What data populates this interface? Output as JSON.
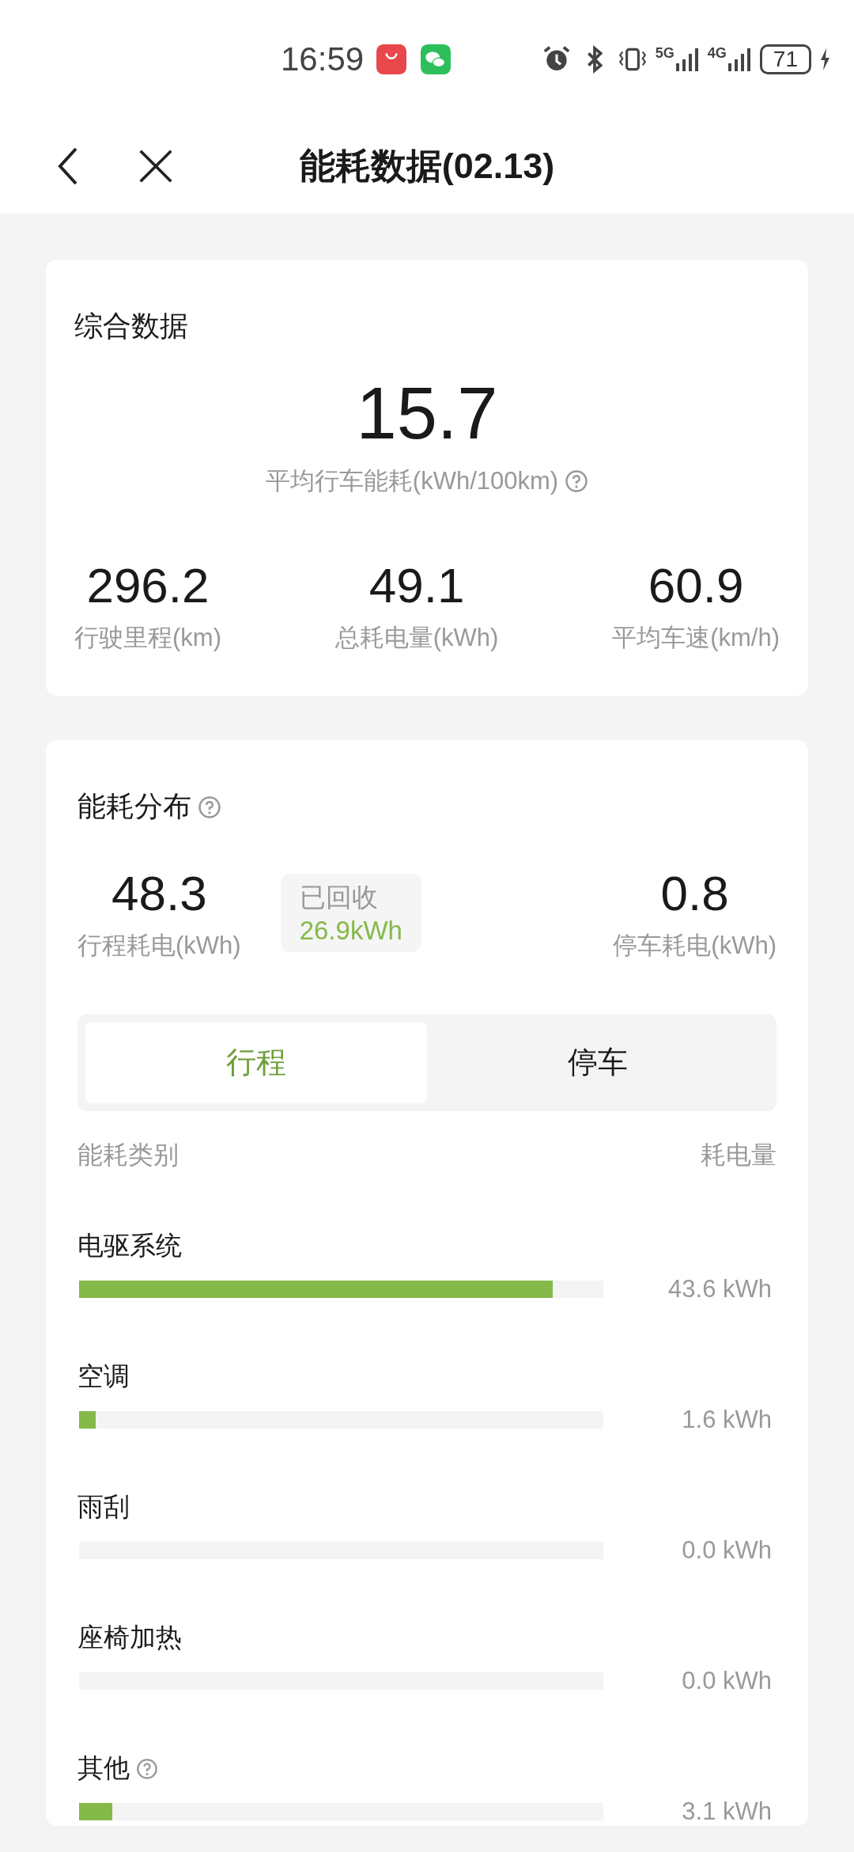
{
  "status_bar": {
    "time": "16:59",
    "network_1": "5G",
    "network_2": "4G",
    "battery": "71"
  },
  "header": {
    "title": "能耗数据(02.13)"
  },
  "summary": {
    "title": "综合数据",
    "main_value": "15.7",
    "main_label": "平均行车能耗(kWh/100km)",
    "stats": [
      {
        "value": "296.2",
        "label": "行驶里程(km)"
      },
      {
        "value": "49.1",
        "label": "总耗电量(kWh)"
      },
      {
        "value": "60.9",
        "label": "平均车速(km/h)"
      }
    ]
  },
  "distribution": {
    "title": "能耗分布",
    "trip_value": "48.3",
    "trip_label": "行程耗电(kWh)",
    "recovered_label": "已回收",
    "recovered_value": "26.9kWh",
    "park_value": "0.8",
    "park_label": "停车耗电(kWh)",
    "tabs": [
      {
        "label": "行程",
        "selected": true
      },
      {
        "label": "停车",
        "selected": false
      }
    ],
    "column_left": "能耗类别",
    "column_right": "耗电量",
    "items": [
      {
        "name": "电驱系统",
        "level": 0.903,
        "value": "43.6 kWh",
        "help": false
      },
      {
        "name": "空调",
        "level": 0.032,
        "value": "1.6 kWh",
        "help": false
      },
      {
        "name": "雨刮",
        "value": "0.0 kWh",
        "help": false
      },
      {
        "name": "座椅加热",
        "value": "0.0 kWh",
        "help": false
      },
      {
        "name": "其他",
        "level": 0.063,
        "value": "3.1 kWh",
        "help": true
      }
    ]
  }
}
